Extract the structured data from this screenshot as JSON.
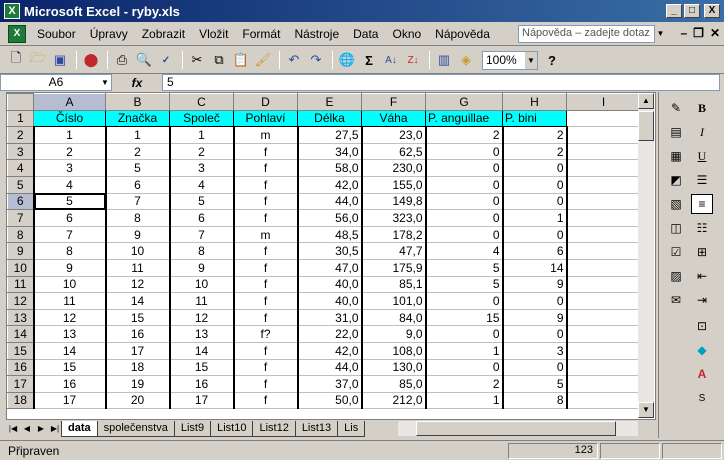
{
  "window": {
    "title": "Microsoft Excel - ryby.xls",
    "app_icon_letter": "X",
    "min_label": "_",
    "max_label": "□",
    "close_label": "X"
  },
  "menu": {
    "items": [
      "Soubor",
      "Úpravy",
      "Zobrazit",
      "Vložit",
      "Formát",
      "Nástroje",
      "Data",
      "Okno",
      "Nápověda"
    ],
    "help_placeholder": "Nápověda – zadejte dotaz",
    "mdi_min": "–",
    "mdi_restore": "❐",
    "mdi_close": "✕"
  },
  "toolbar": {
    "icons": [
      "new-icon",
      "open-icon",
      "save-icon",
      "permission-icon",
      "print-icon",
      "print-preview-icon",
      "spelling-icon",
      "cut-icon",
      "copy-icon",
      "paste-icon",
      "format-painter-icon",
      "undo-icon",
      "redo-icon",
      "hyperlink-icon",
      "autosum-icon",
      "sort-ascending-icon",
      "sort-descending-icon",
      "chart-wizard-icon",
      "drawing-icon",
      "help-icon"
    ],
    "zoom": "100%"
  },
  "formula": {
    "name_box": "A6",
    "fx_label": "fx",
    "value": "5"
  },
  "grid": {
    "columns": [
      "A",
      "B",
      "C",
      "D",
      "E",
      "F",
      "G",
      "H",
      "I"
    ],
    "row_numbers": [
      "1",
      "2",
      "3",
      "4",
      "5",
      "6",
      "7",
      "8",
      "9",
      "10",
      "11",
      "12",
      "13",
      "14",
      "15",
      "16",
      "17",
      "18"
    ],
    "headers": [
      "Číslo",
      "Značka",
      "Společ",
      "Pohlaví",
      "Délka",
      "Váha",
      "P. anguillae",
      "P. bini"
    ],
    "rows": [
      [
        "1",
        "1",
        "1",
        "m",
        "27,5",
        "23,0",
        "2",
        "2"
      ],
      [
        "2",
        "2",
        "2",
        "f",
        "34,0",
        "62,5",
        "0",
        "2"
      ],
      [
        "3",
        "5",
        "3",
        "f",
        "58,0",
        "230,0",
        "0",
        "0"
      ],
      [
        "4",
        "6",
        "4",
        "f",
        "42,0",
        "155,0",
        "0",
        "0"
      ],
      [
        "5",
        "7",
        "5",
        "f",
        "44,0",
        "149,8",
        "0",
        "0"
      ],
      [
        "6",
        "8",
        "6",
        "f",
        "56,0",
        "323,0",
        "0",
        "1"
      ],
      [
        "7",
        "9",
        "7",
        "m",
        "48,5",
        "178,2",
        "0",
        "0"
      ],
      [
        "8",
        "10",
        "8",
        "f",
        "30,5",
        "47,7",
        "4",
        "6"
      ],
      [
        "9",
        "11",
        "9",
        "f",
        "47,0",
        "175,9",
        "5",
        "14"
      ],
      [
        "10",
        "12",
        "10",
        "f",
        "40,0",
        "85,1",
        "5",
        "9"
      ],
      [
        "11",
        "14",
        "11",
        "f",
        "40,0",
        "101,0",
        "0",
        "0"
      ],
      [
        "12",
        "15",
        "12",
        "f",
        "31,0",
        "84,0",
        "15",
        "9"
      ],
      [
        "13",
        "16",
        "13",
        "f?",
        "22,0",
        "9,0",
        "0",
        "0"
      ],
      [
        "14",
        "17",
        "14",
        "f",
        "42,0",
        "108,0",
        "1",
        "3"
      ],
      [
        "15",
        "18",
        "15",
        "f",
        "44,0",
        "130,0",
        "0",
        "0"
      ],
      [
        "16",
        "19",
        "16",
        "f",
        "37,0",
        "85,0",
        "2",
        "5"
      ],
      [
        "17",
        "20",
        "17",
        "f",
        "50,0",
        "212,0",
        "1",
        "8"
      ]
    ]
  },
  "sheets": {
    "tabs": [
      "data",
      "společenstva",
      "List9",
      "List10",
      "List12",
      "List13",
      "Lis"
    ],
    "active": "data"
  },
  "status": {
    "text": "Připraven",
    "sum_value": "123"
  }
}
